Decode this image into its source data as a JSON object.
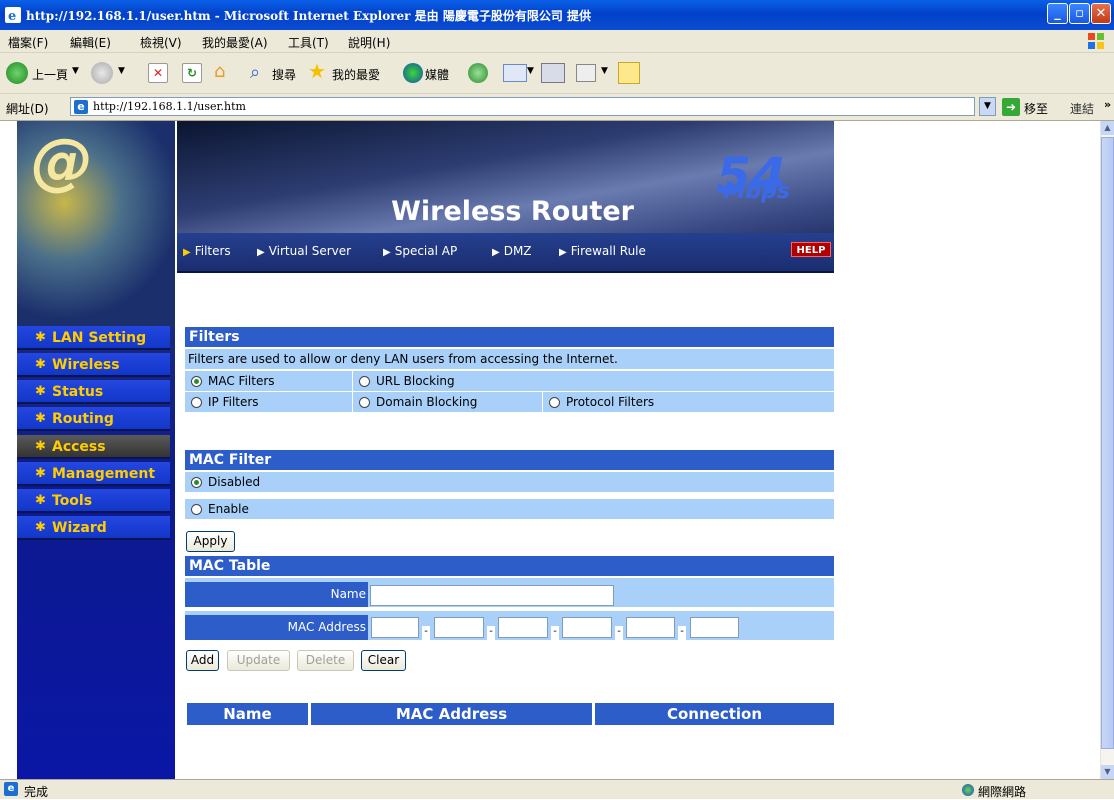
{
  "window": {
    "title": "http://192.168.1.1/user.htm - Microsoft Internet Explorer 是由 陽慶電子股份有限公司 提供"
  },
  "menu": [
    "檔案(F)",
    "編輯(E)",
    "檢視(V)",
    "我的最愛(A)",
    "工具(T)",
    "說明(H)"
  ],
  "toolbar": {
    "back": "上一頁",
    "search": "搜尋",
    "favorites": "我的最愛",
    "media": "媒體"
  },
  "address": {
    "label": "網址(D)",
    "url": "http://192.168.1.1/user.htm",
    "go": "移至",
    "links": "連結"
  },
  "status": {
    "left": "完成",
    "zone": "網際網路"
  },
  "banner": {
    "brand": "Wireless Router",
    "speed": "54",
    "unit": "Mbps",
    "help": "HELP",
    "tabs": [
      "Filters",
      "Virtual Server",
      "Special AP",
      "DMZ",
      "Firewall Rule"
    ]
  },
  "sidebar": {
    "items": [
      "LAN Setting",
      "Wireless",
      "Status",
      "Routing",
      "Access",
      "Management",
      "Tools",
      "Wizard"
    ],
    "active": "Access"
  },
  "filters": {
    "title": "Filters",
    "description": "Filters are used to allow or deny LAN users from accessing the Internet.",
    "options": {
      "mac": "MAC Filters",
      "url": "URL Blocking",
      "ip": "IP Filters",
      "domain": "Domain Blocking",
      "protocol": "Protocol Filters"
    },
    "selected": "MAC Filters"
  },
  "mac_filter": {
    "title": "MAC Filter",
    "disabled": "Disabled",
    "enable": "Enable",
    "selected": "Disabled",
    "apply": "Apply"
  },
  "mac_table": {
    "title": "MAC Table",
    "name_label": "Name",
    "mac_label": "MAC Address",
    "add": "Add",
    "update": "Update",
    "delete": "Delete",
    "clear": "Clear",
    "columns": [
      "Name",
      "MAC Address",
      "Connection"
    ]
  }
}
